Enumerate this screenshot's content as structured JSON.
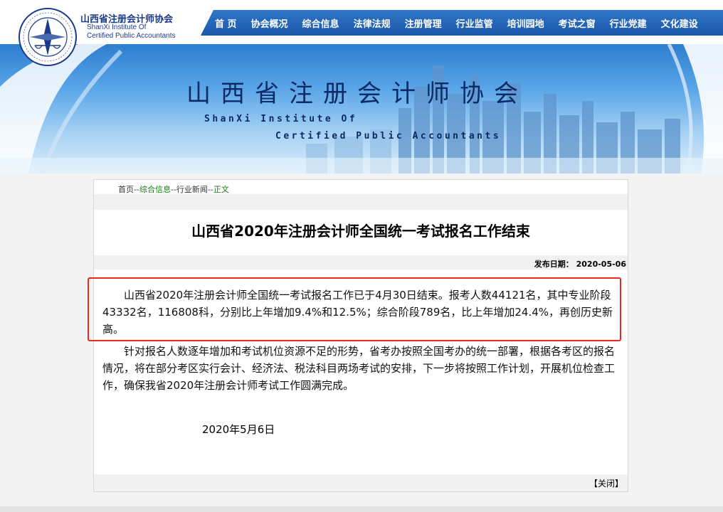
{
  "header": {
    "org_name_cn": "山西省注册会计师协会",
    "org_name_en_line1": "ShanXi Institute Of",
    "org_name_en_line2": "Certified Public Accountants",
    "nav": [
      "首 页",
      "协会概况",
      "综合信息",
      "法律法规",
      "注册管理",
      "行业监管",
      "培训园地",
      "考试之窗",
      "行业党建",
      "文化建设"
    ]
  },
  "banner": {
    "title": "山西省注册会计师协会",
    "subtitle_line1": "ShanXi Institute Of",
    "subtitle_line2": "Certified Public Accountants"
  },
  "breadcrumb": {
    "home": "首页",
    "sep": "--",
    "c1": "综合信息",
    "c2": "行业新闻",
    "c3": "正文"
  },
  "article": {
    "title": "山西省2020年注册会计师全国统一考试报名工作结束",
    "publish_date_label": "发布日期：",
    "publish_date": "2020-05-06",
    "paragraph1": "山西省2020年注册会计师全国统一考试报名工作已于4月30日结束。报考人数44121名，其中专业阶段43332名，116808科，分别比上年增加9.4%和12.5%；综合阶段789名，比上年增加24.4%，再创历史新高。",
    "paragraph2": "针对报名人数逐年增加和考试机位资源不足的形势，省考办按照全国考办的统一部署，根据各考区的报名情况，将在部分考区实行会计、经济法、税法科目两场考试的安排，下一步将按照工作计划，开展机位检查工作，确保我省2020年注册会计师考试工作圆满完成。",
    "sign_date": "2020年5月6日",
    "close_label": "【关闭】"
  },
  "colors": {
    "nav_bg": "#1b57a8",
    "highlight_border": "#e8291f",
    "breadcrumb_link": "#1a7a1a"
  }
}
